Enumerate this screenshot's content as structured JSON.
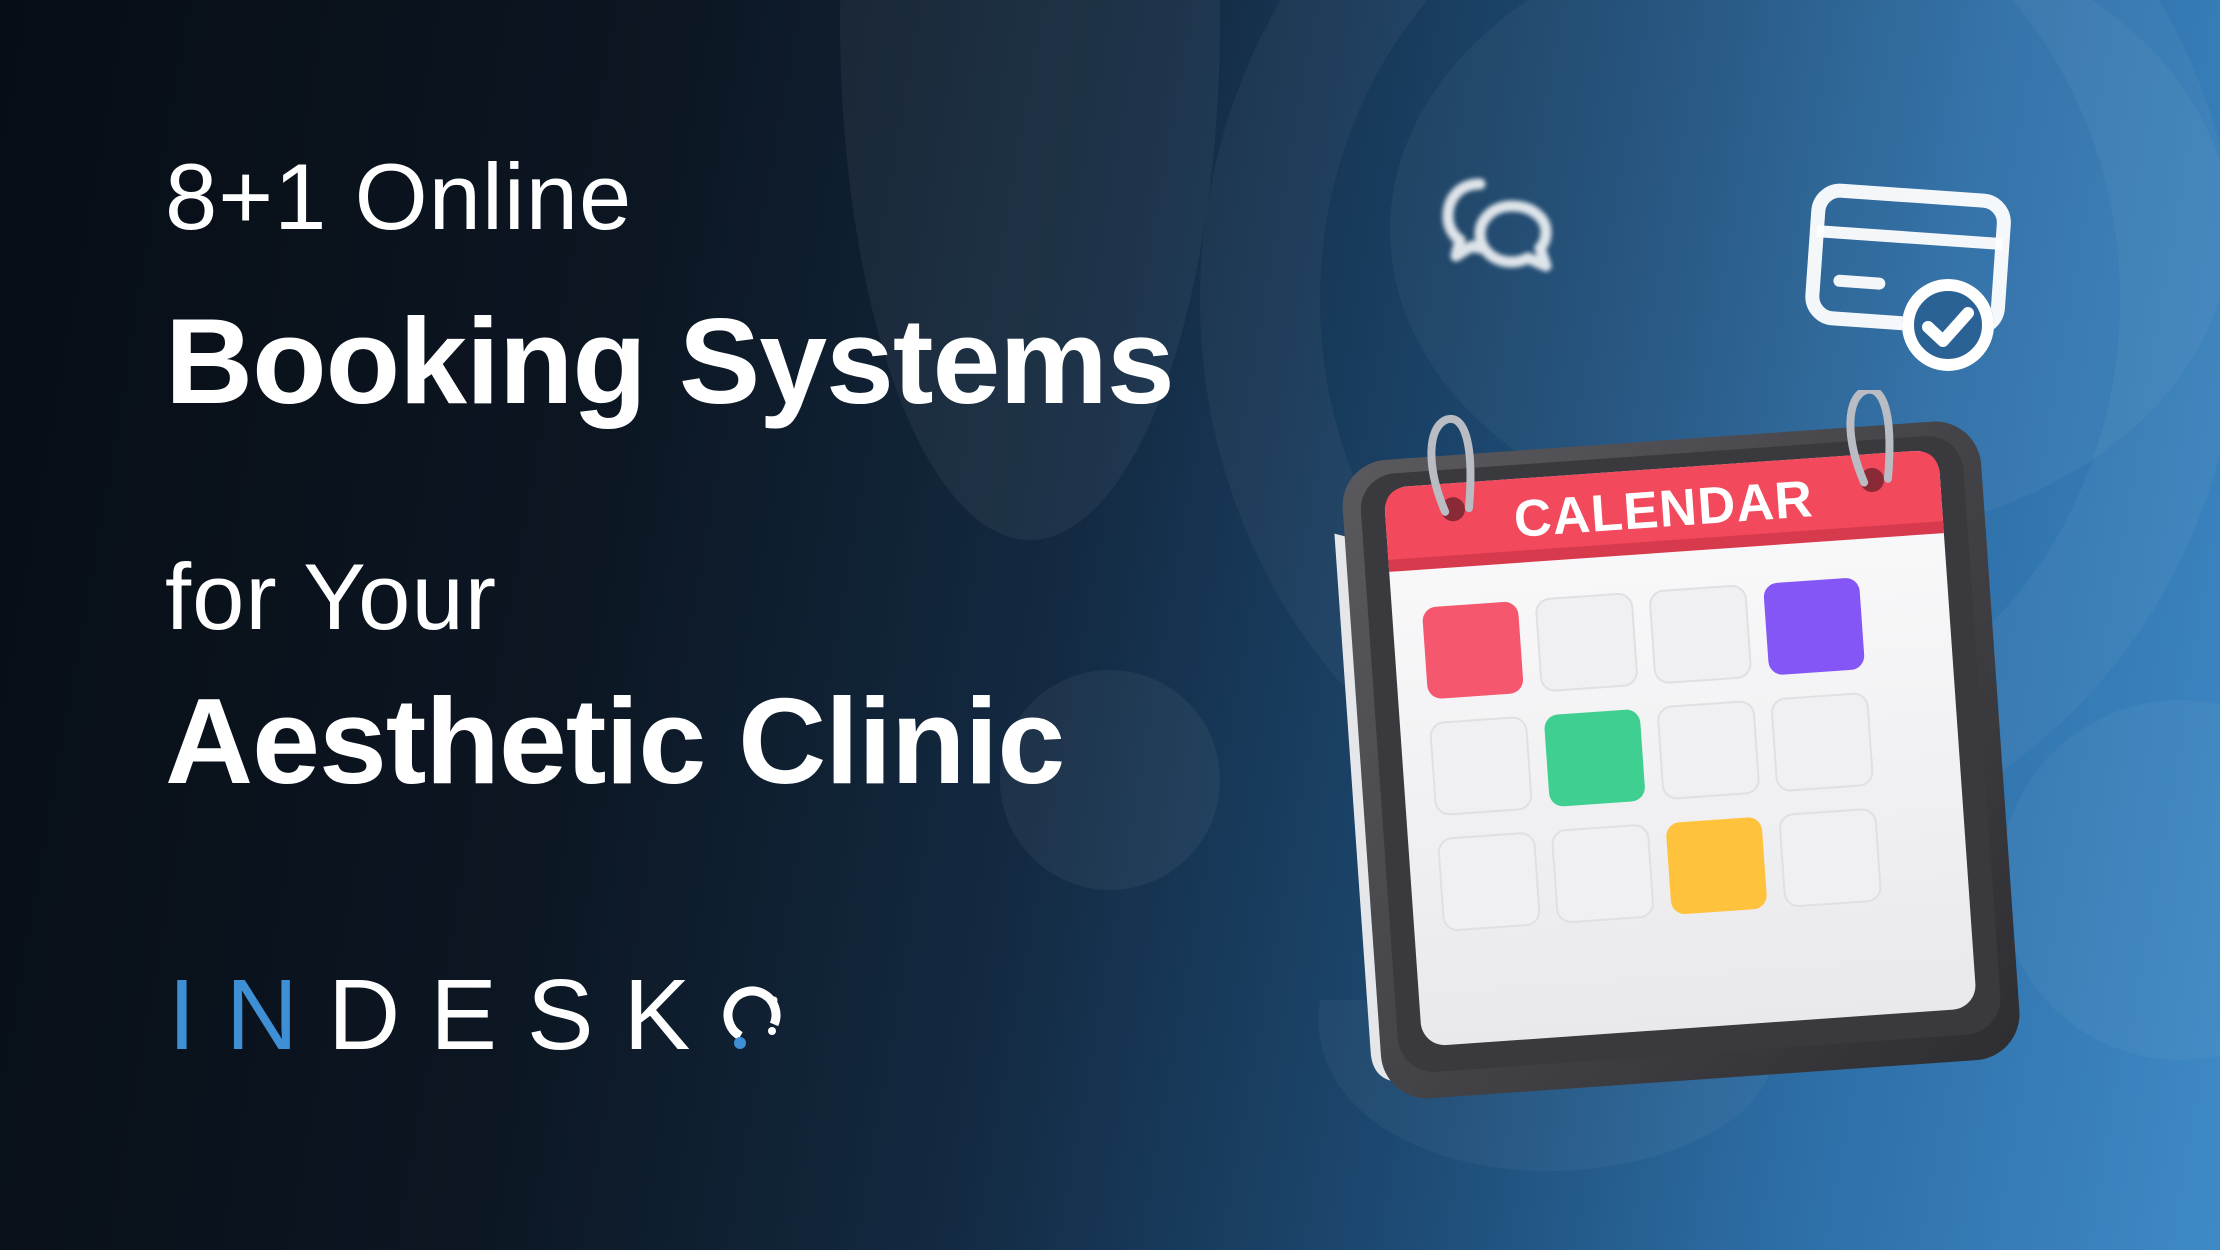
{
  "headline": {
    "line1": "8+1 Online",
    "line2": "Booking Systems",
    "line3": "for Your",
    "line4": "Aesthetic Clinic"
  },
  "brand": {
    "name_accent": "IN",
    "name_rest": "DESK",
    "accent_color": "#3f8fd4"
  },
  "calendar": {
    "title": "CALENDAR",
    "header_color": "#f2495c",
    "highlight_colors": {
      "red": "#f4576e",
      "purple": "#8456f5",
      "green": "#3fcf90",
      "yellow": "#ffc23d"
    }
  },
  "icons": [
    "chat-bubbles-icon",
    "card-check-icon",
    "logo-ring-icon"
  ]
}
